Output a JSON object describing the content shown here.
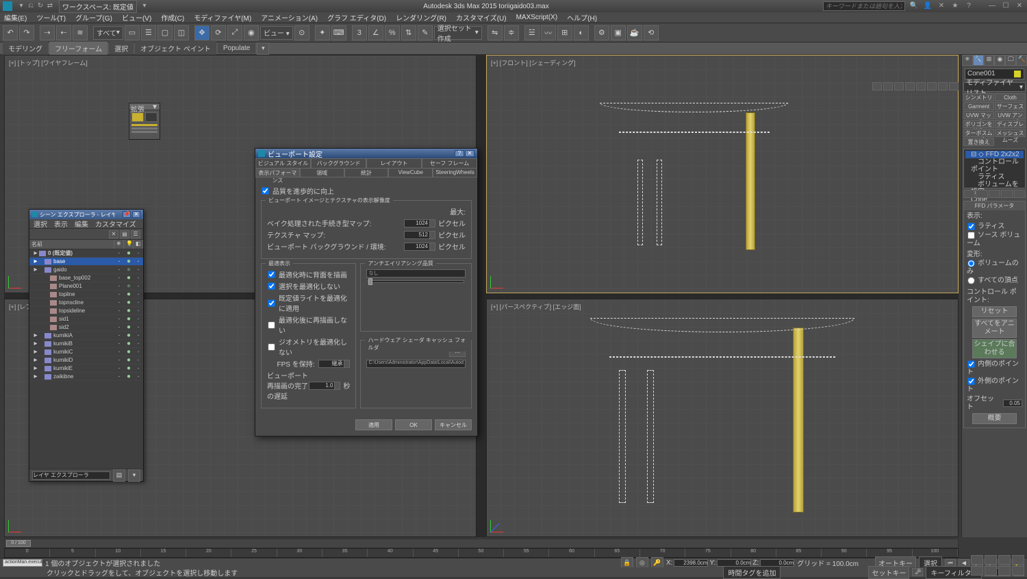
{
  "titlebar": {
    "workspace_label": "ワークスペース: 既定値",
    "center": "Autodesk 3ds Max 2015   toriigaido03.max",
    "search_placeholder": "キーワードまたは語句を入力"
  },
  "menubar": [
    "編集(E)",
    "ツール(T)",
    "グループ(G)",
    "ビュー(V)",
    "作成(C)",
    "モディファイヤ(M)",
    "アニメーション(A)",
    "グラフ エディタ(D)",
    "レンダリング(R)",
    "カスタマイズ(U)",
    "MAXScript(X)",
    "ヘルプ(H)"
  ],
  "maintoolbar": {
    "select_filter": "すべて",
    "selset_dropdown": "選択セット作成"
  },
  "ribbon": {
    "tabs": [
      "モデリング",
      "フリーフォーム",
      "選択",
      "オブジェクト ペイント",
      "Populate"
    ]
  },
  "viewports": {
    "tl_label": "[+] [トップ] [ワイヤフレーム]",
    "tr_label": "[+] [フロント] [シェーディング]",
    "bl_label": "[+] [レフト] [ワイヤフレーム]",
    "br_label": "[+] [パースペクティブ] [エッジ面]"
  },
  "scene_explorer": {
    "title": "シーン エクスプローラ - レイヤ エクスプローラ",
    "menu": [
      "選択",
      "表示",
      "編集",
      "カスタマイズ"
    ],
    "head_name": "名前",
    "foot_label": "レイヤ エクスプローラ",
    "rows": [
      {
        "name": "0 (既定値)",
        "indent": 0,
        "sel": false,
        "ico": "t",
        "bold": true
      },
      {
        "name": "base",
        "indent": 1,
        "sel": true,
        "ico": "t"
      },
      {
        "name": "gaido",
        "indent": 1,
        "sel": false,
        "ico": "t",
        "bulb": "dim"
      },
      {
        "name": "base_top002",
        "indent": 2,
        "sel": false,
        "ico": "o"
      },
      {
        "name": "Plane001",
        "indent": 2,
        "sel": false,
        "ico": "o",
        "bulb": "dim"
      },
      {
        "name": "topline",
        "indent": 2,
        "sel": false,
        "ico": "o"
      },
      {
        "name": "topnscline",
        "indent": 2,
        "sel": false,
        "ico": "o"
      },
      {
        "name": "topsideline",
        "indent": 2,
        "sel": false,
        "ico": "o"
      },
      {
        "name": "sid1",
        "indent": 2,
        "sel": false,
        "ico": "o"
      },
      {
        "name": "sid2",
        "indent": 2,
        "sel": false,
        "ico": "o"
      },
      {
        "name": "kumikiA",
        "indent": 1,
        "sel": false,
        "ico": "t"
      },
      {
        "name": "kumikiB",
        "indent": 1,
        "sel": false,
        "ico": "t"
      },
      {
        "name": "kumikiC",
        "indent": 1,
        "sel": false,
        "ico": "t"
      },
      {
        "name": "kumikiD",
        "indent": 1,
        "sel": false,
        "ico": "t"
      },
      {
        "name": "kumikiE",
        "indent": 1,
        "sel": false,
        "ico": "t"
      },
      {
        "name": "zaikibne",
        "indent": 1,
        "sel": false,
        "ico": "t"
      }
    ]
  },
  "dialog": {
    "title": "ビューポート設定",
    "tabs_top": [
      "ビジュアル スタイルと外観",
      "バックグラウンド",
      "レイアウト",
      "セーフ フレーム"
    ],
    "tabs_bottom": [
      "表示パフォーマンス",
      "領域",
      "統計",
      "ViewCube",
      "SteeringWheels"
    ],
    "active_tab": "表示パフォーマンス",
    "progressive_label": "品質を進歩的に向上",
    "group_res": {
      "title": "ビューポート イメージとテクスチャの表示解像度",
      "max_label": "最大:",
      "rows": [
        {
          "label": "ベイク処理された手続き型マップ:",
          "value": "1024",
          "unit": "ピクセル"
        },
        {
          "label": "テクスチャ マップ:",
          "value": "512",
          "unit": "ピクセル"
        },
        {
          "label": "ビューポート バックグラウンド / 環境:",
          "value": "1024",
          "unit": "ピクセル"
        }
      ]
    },
    "group_adaptive": {
      "title": "最適表示",
      "checks": [
        {
          "label": "最適化時に背面を描画",
          "checked": true
        },
        {
          "label": "選択を最適化しない",
          "checked": true
        },
        {
          "label": "既定値ライトを最適化に適用",
          "checked": true
        },
        {
          "label": "最適化後に再描画しない",
          "checked": false
        },
        {
          "label": "ジオメトリを最適化しない",
          "checked": false
        }
      ],
      "fps_label": "FPS を保持:",
      "fps_value": "継承",
      "delay_label": "ビューポート再描画の完了の遅延",
      "delay_value": "1.0"
    },
    "group_aa": {
      "title": "アンチエイリアシング品質",
      "value": "なし"
    },
    "group_cache": {
      "title": "ハードウェア シェーダ キャッシュ フォルダ",
      "path": "C:\\Users\\Administrator\\AppData\\Local\\Autod",
      "browse": "..."
    },
    "buttons": {
      "apply": "適用",
      "ok": "OK",
      "cancel": "キャンセル"
    }
  },
  "cmdpanel": {
    "name": "Cone001",
    "mod_dropdown": "モディファイヤ リスト",
    "mod_buttons": [
      "シンメトリ",
      "Cloth",
      "Garment Maker",
      "サーフェス",
      "UVW マップ",
      "UVW アンラップ",
      "ポリゴンを編集",
      "ディスプレイス",
      "ターボスムーズ",
      "メッシュスムーズ",
      "置き換え"
    ],
    "stack": [
      "FFD 2x2x2",
      "　コントロール ポイント",
      "　ラティス",
      "　ボリュームを設定",
      "Cone"
    ],
    "rollout1": {
      "title": "FFD パラメータ",
      "display_label": "表示:",
      "chk_lattice": "ラティス",
      "chk_source": "ソース ボリューム",
      "deform_label": "変形:",
      "rad_vol": "ボリュームのみ",
      "rad_all": "すべての頂点",
      "cp_label": "コントロール ポイント:",
      "btn_reset": "リセット",
      "btn_anim": "すべてをアニメート",
      "btn_fit": "シェイプに合わせる",
      "chk_in": "内側のポイント",
      "chk_out": "外側のポイント",
      "offset_label": "オフセット",
      "offset_value": "0.05",
      "btn_about": "概要"
    }
  },
  "status": {
    "script_label": "actionMan.executeA",
    "msg1": "1 個のオブジェクトが選択されました",
    "msg2": "クリックとドラッグをして、オブジェクトを選択し移動します",
    "coords": {
      "x_label": "X:",
      "x": "2398.0cm",
      "y_label": "Y:",
      "y": "0.0cm",
      "z_label": "Z:",
      "z": "0.0cm"
    },
    "grid": "グリッド = 100.0cm",
    "autokey": "オートキー",
    "setkey": "セットキー",
    "selected_label": "選択",
    "keyfilter": "キーフィルタ...",
    "time_btn": "時間タグを追加",
    "slider": "0 / 100"
  },
  "timeline_ticks": [
    "0",
    "5",
    "10",
    "15",
    "20",
    "25",
    "30",
    "35",
    "40",
    "45",
    "50",
    "55",
    "60",
    "65",
    "70",
    "75",
    "80",
    "85",
    "90",
    "95",
    "100"
  ]
}
